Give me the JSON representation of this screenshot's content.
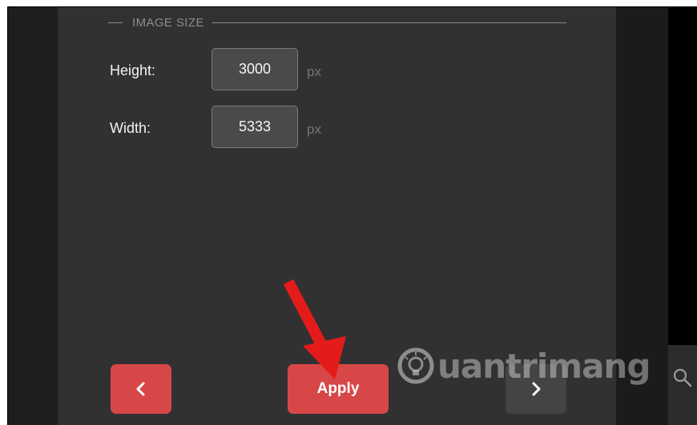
{
  "section": {
    "title": "IMAGE SIZE"
  },
  "fields": {
    "height": {
      "label": "Height:",
      "value": "3000",
      "unit": "px"
    },
    "width": {
      "label": "Width:",
      "value": "5333",
      "unit": "px"
    }
  },
  "buttons": {
    "prev_icon": "chevron-left-icon",
    "apply_label": "Apply",
    "next_icon": "chevron-right-icon"
  },
  "watermark": {
    "text": "uantrimang"
  },
  "colors": {
    "panel": "#313131",
    "accent_red": "#d84748",
    "input_bg": "#4a4a4a",
    "annotation_arrow": "#e41b1b"
  }
}
